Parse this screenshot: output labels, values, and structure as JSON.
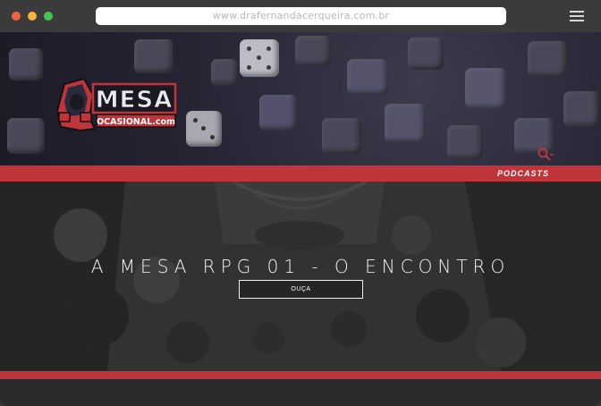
{
  "browser": {
    "url": "www.drafernandacerqueira.com.br"
  },
  "header": {
    "logo_main": "MESA",
    "logo_sub": "OCASIONAL.com"
  },
  "nav": {
    "items": [
      {
        "label": "PODCASTS"
      }
    ]
  },
  "hero": {
    "title": "A MESA RPG 01 - O ENCONTRO",
    "button_label": "OUÇA"
  },
  "colors": {
    "accent": "#c0353a",
    "titlebar": "#3b3b3b",
    "footer": "#2b2b2b"
  }
}
